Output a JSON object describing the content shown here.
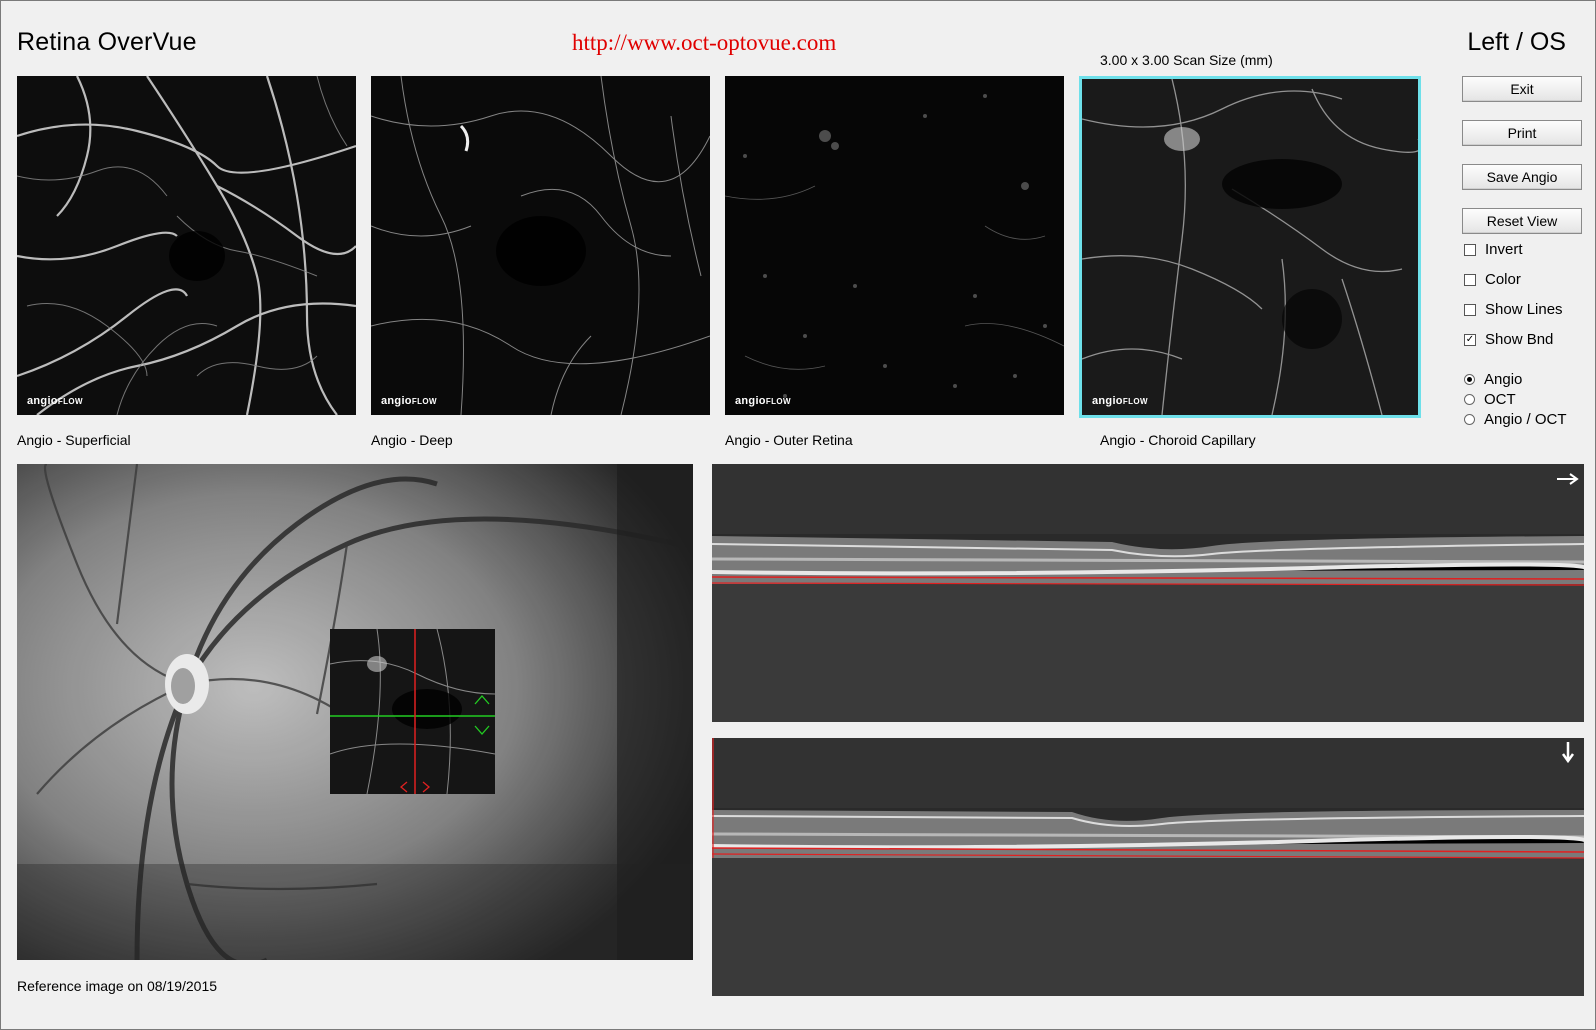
{
  "header": {
    "app_title": "Retina OverVue",
    "url": "http://www.oct-optovue.com",
    "eye": "Left / OS",
    "scan_size": "3.00 x 3.00 Scan Size (mm)"
  },
  "panels": [
    {
      "caption": "Angio - Superficial",
      "badge_main": "angio",
      "badge_small": "FLOW"
    },
    {
      "caption": "Angio - Deep",
      "badge_main": "angio",
      "badge_small": "FLOW"
    },
    {
      "caption": "Angio - Outer Retina",
      "badge_main": "angio",
      "badge_small": "FLOW"
    },
    {
      "caption": "Angio - Choroid Capillary",
      "badge_main": "angio",
      "badge_small": "FLOW"
    }
  ],
  "buttons": {
    "exit": "Exit",
    "print": "Print",
    "save_angio": "Save Angio",
    "reset_view": "Reset View"
  },
  "checkboxes": [
    {
      "label": "Invert",
      "checked": false
    },
    {
      "label": "Color",
      "checked": false
    },
    {
      "label": "Show Lines",
      "checked": false
    },
    {
      "label": "Show Bnd",
      "checked": true
    }
  ],
  "radios": [
    {
      "label": "Angio",
      "selected": true
    },
    {
      "label": "OCT",
      "selected": false
    },
    {
      "label": "Angio / OCT",
      "selected": false
    }
  ],
  "reference": {
    "caption": "Reference image on 08/19/2015"
  },
  "icons": {
    "bscan_top": "arrow-right-icon",
    "bscan_bottom": "arrow-down-icon"
  },
  "colors": {
    "selected_border": "#6ee0ea",
    "url_red": "#e00000",
    "boundary_red": "#e02020",
    "crosshair_green": "#22cc22"
  }
}
